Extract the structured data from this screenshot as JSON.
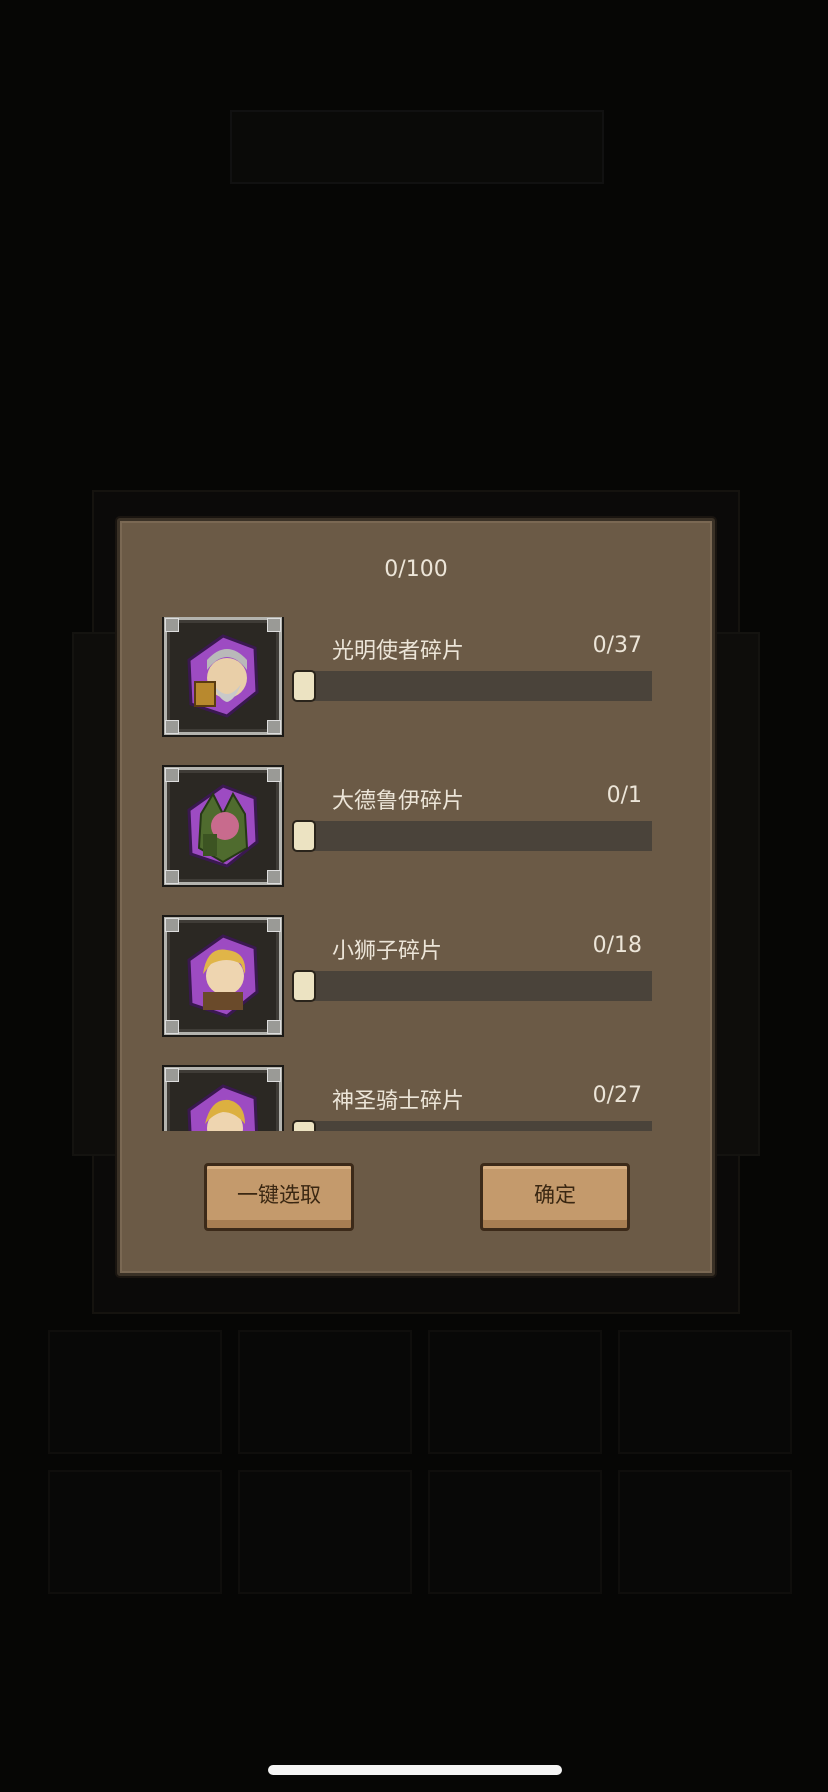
{
  "dialog": {
    "total_counter": "0/100",
    "items": [
      {
        "name": "光明使者碎片",
        "count": "0/37",
        "progress": 0,
        "icon": "mage-hero-portrait-icon"
      },
      {
        "name": "大德鲁伊碎片",
        "count": "0/1",
        "progress": 0,
        "icon": "druid-hero-portrait-icon"
      },
      {
        "name": "小狮子碎片",
        "count": "0/18",
        "progress": 0,
        "icon": "lion-hero-portrait-icon"
      },
      {
        "name": "神圣骑士碎片",
        "count": "0/27",
        "progress": 0,
        "icon": "paladin-hero-portrait-icon"
      }
    ],
    "select_all_label": "一键选取",
    "confirm_label": "确定"
  },
  "colors": {
    "panel": "#6b5a46",
    "track": "#4a433a",
    "button": "#c49a6c",
    "text": "#ece5d8",
    "shard_purple": "#9d4bc2"
  }
}
